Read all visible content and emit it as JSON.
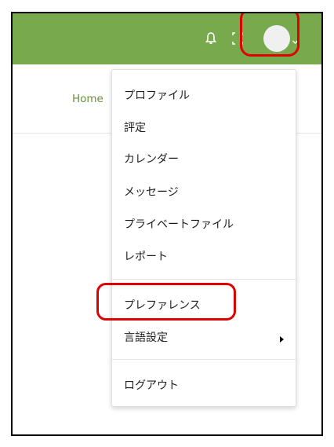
{
  "header": {
    "bar_color": "#78a94d",
    "icons": [
      "bell-icon",
      "screen-icon",
      "avatar",
      "chevron-down-icon"
    ]
  },
  "breadcrumb": {
    "home": "Home"
  },
  "user_menu": {
    "items": [
      {
        "label": "プロファイル"
      },
      {
        "label": "評定"
      },
      {
        "label": "カレンダー"
      },
      {
        "label": "メッセージ"
      },
      {
        "label": "プライベートファイル"
      },
      {
        "label": "レポート"
      },
      {
        "label": "プレファレンス"
      },
      {
        "label": "言語設定"
      },
      {
        "label": "ログアウト"
      }
    ]
  },
  "highlights": {
    "color": "#e00000"
  }
}
